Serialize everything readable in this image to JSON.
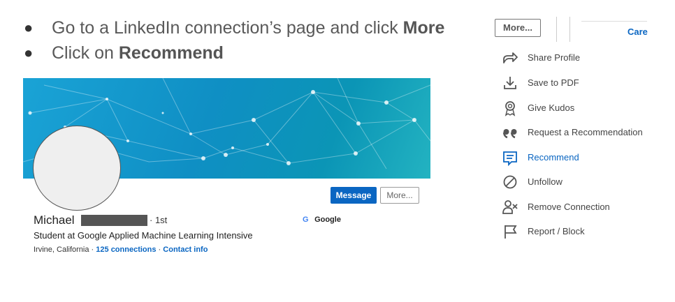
{
  "instructions": [
    {
      "prefix": "Go to a LinkedIn connection’s page and click ",
      "bold": "More"
    },
    {
      "prefix": "Click on ",
      "bold": "Recommend"
    }
  ],
  "bullet_char": "●",
  "profile": {
    "first_name": "Michael",
    "degree": "· 1st",
    "headline": "Student at Google Applied Machine Learning Intensive",
    "location": "Irvine, California",
    "separator": "·",
    "connections": "125 connections",
    "contact": "Contact info",
    "company_logo": "G",
    "company": "Google",
    "message_button": "Message",
    "more_button": "More..."
  },
  "dropdown": {
    "more_button": "More...",
    "partial_tab": "Care",
    "items": [
      {
        "label": "Share Profile",
        "icon": "share-icon"
      },
      {
        "label": "Save to PDF",
        "icon": "download-icon"
      },
      {
        "label": "Give Kudos",
        "icon": "kudos-icon"
      },
      {
        "label": "Request a Recommendation",
        "icon": "quote-icon"
      },
      {
        "label": "Recommend",
        "icon": "recommend-icon",
        "active": true
      },
      {
        "label": "Unfollow",
        "icon": "unfollow-icon"
      },
      {
        "label": "Remove Connection",
        "icon": "remove-connection-icon"
      },
      {
        "label": "Report / Block",
        "icon": "flag-icon"
      }
    ]
  },
  "colors": {
    "accent": "#0a66c2",
    "banner": "#1aa3d6"
  }
}
